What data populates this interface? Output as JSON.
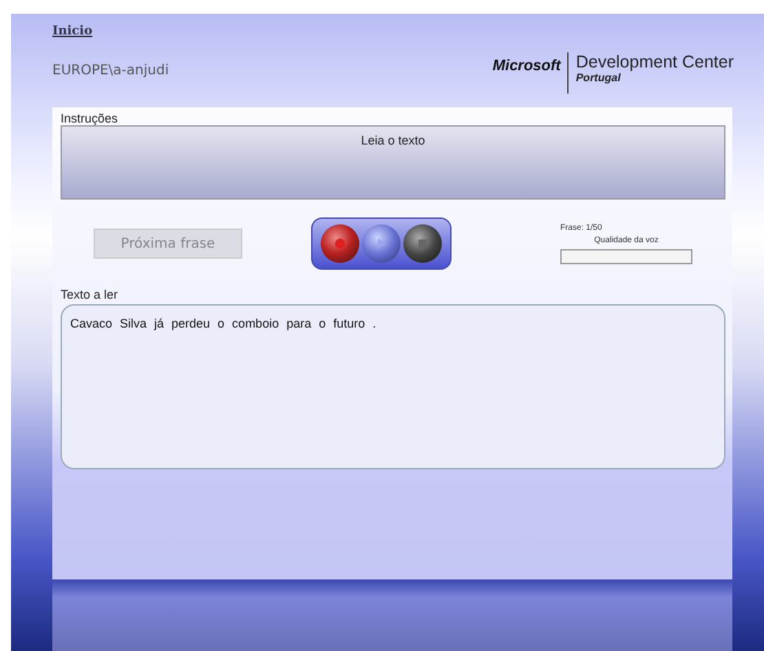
{
  "header": {
    "home_link": "Inicio",
    "user": "EUROPE\\a-anjudi",
    "logo": {
      "brand": "Microsoft",
      "title": "Development Center",
      "subtitle": "Portugal"
    }
  },
  "instructions": {
    "label": "Instruções",
    "text": "Leia o texto"
  },
  "next_button": {
    "label": "Próxima frase",
    "disabled": true
  },
  "media_buttons": [
    {
      "kind": "record"
    },
    {
      "kind": "play"
    },
    {
      "kind": "stop"
    }
  ],
  "sentence_counter": "Frase: 1/50",
  "voice_quality": {
    "label": "Qualidade da voz",
    "level": 0
  },
  "reading": {
    "label": "Texto a ler",
    "text": "Cavaco Silva já perdeu o comboio para o futuro ."
  }
}
